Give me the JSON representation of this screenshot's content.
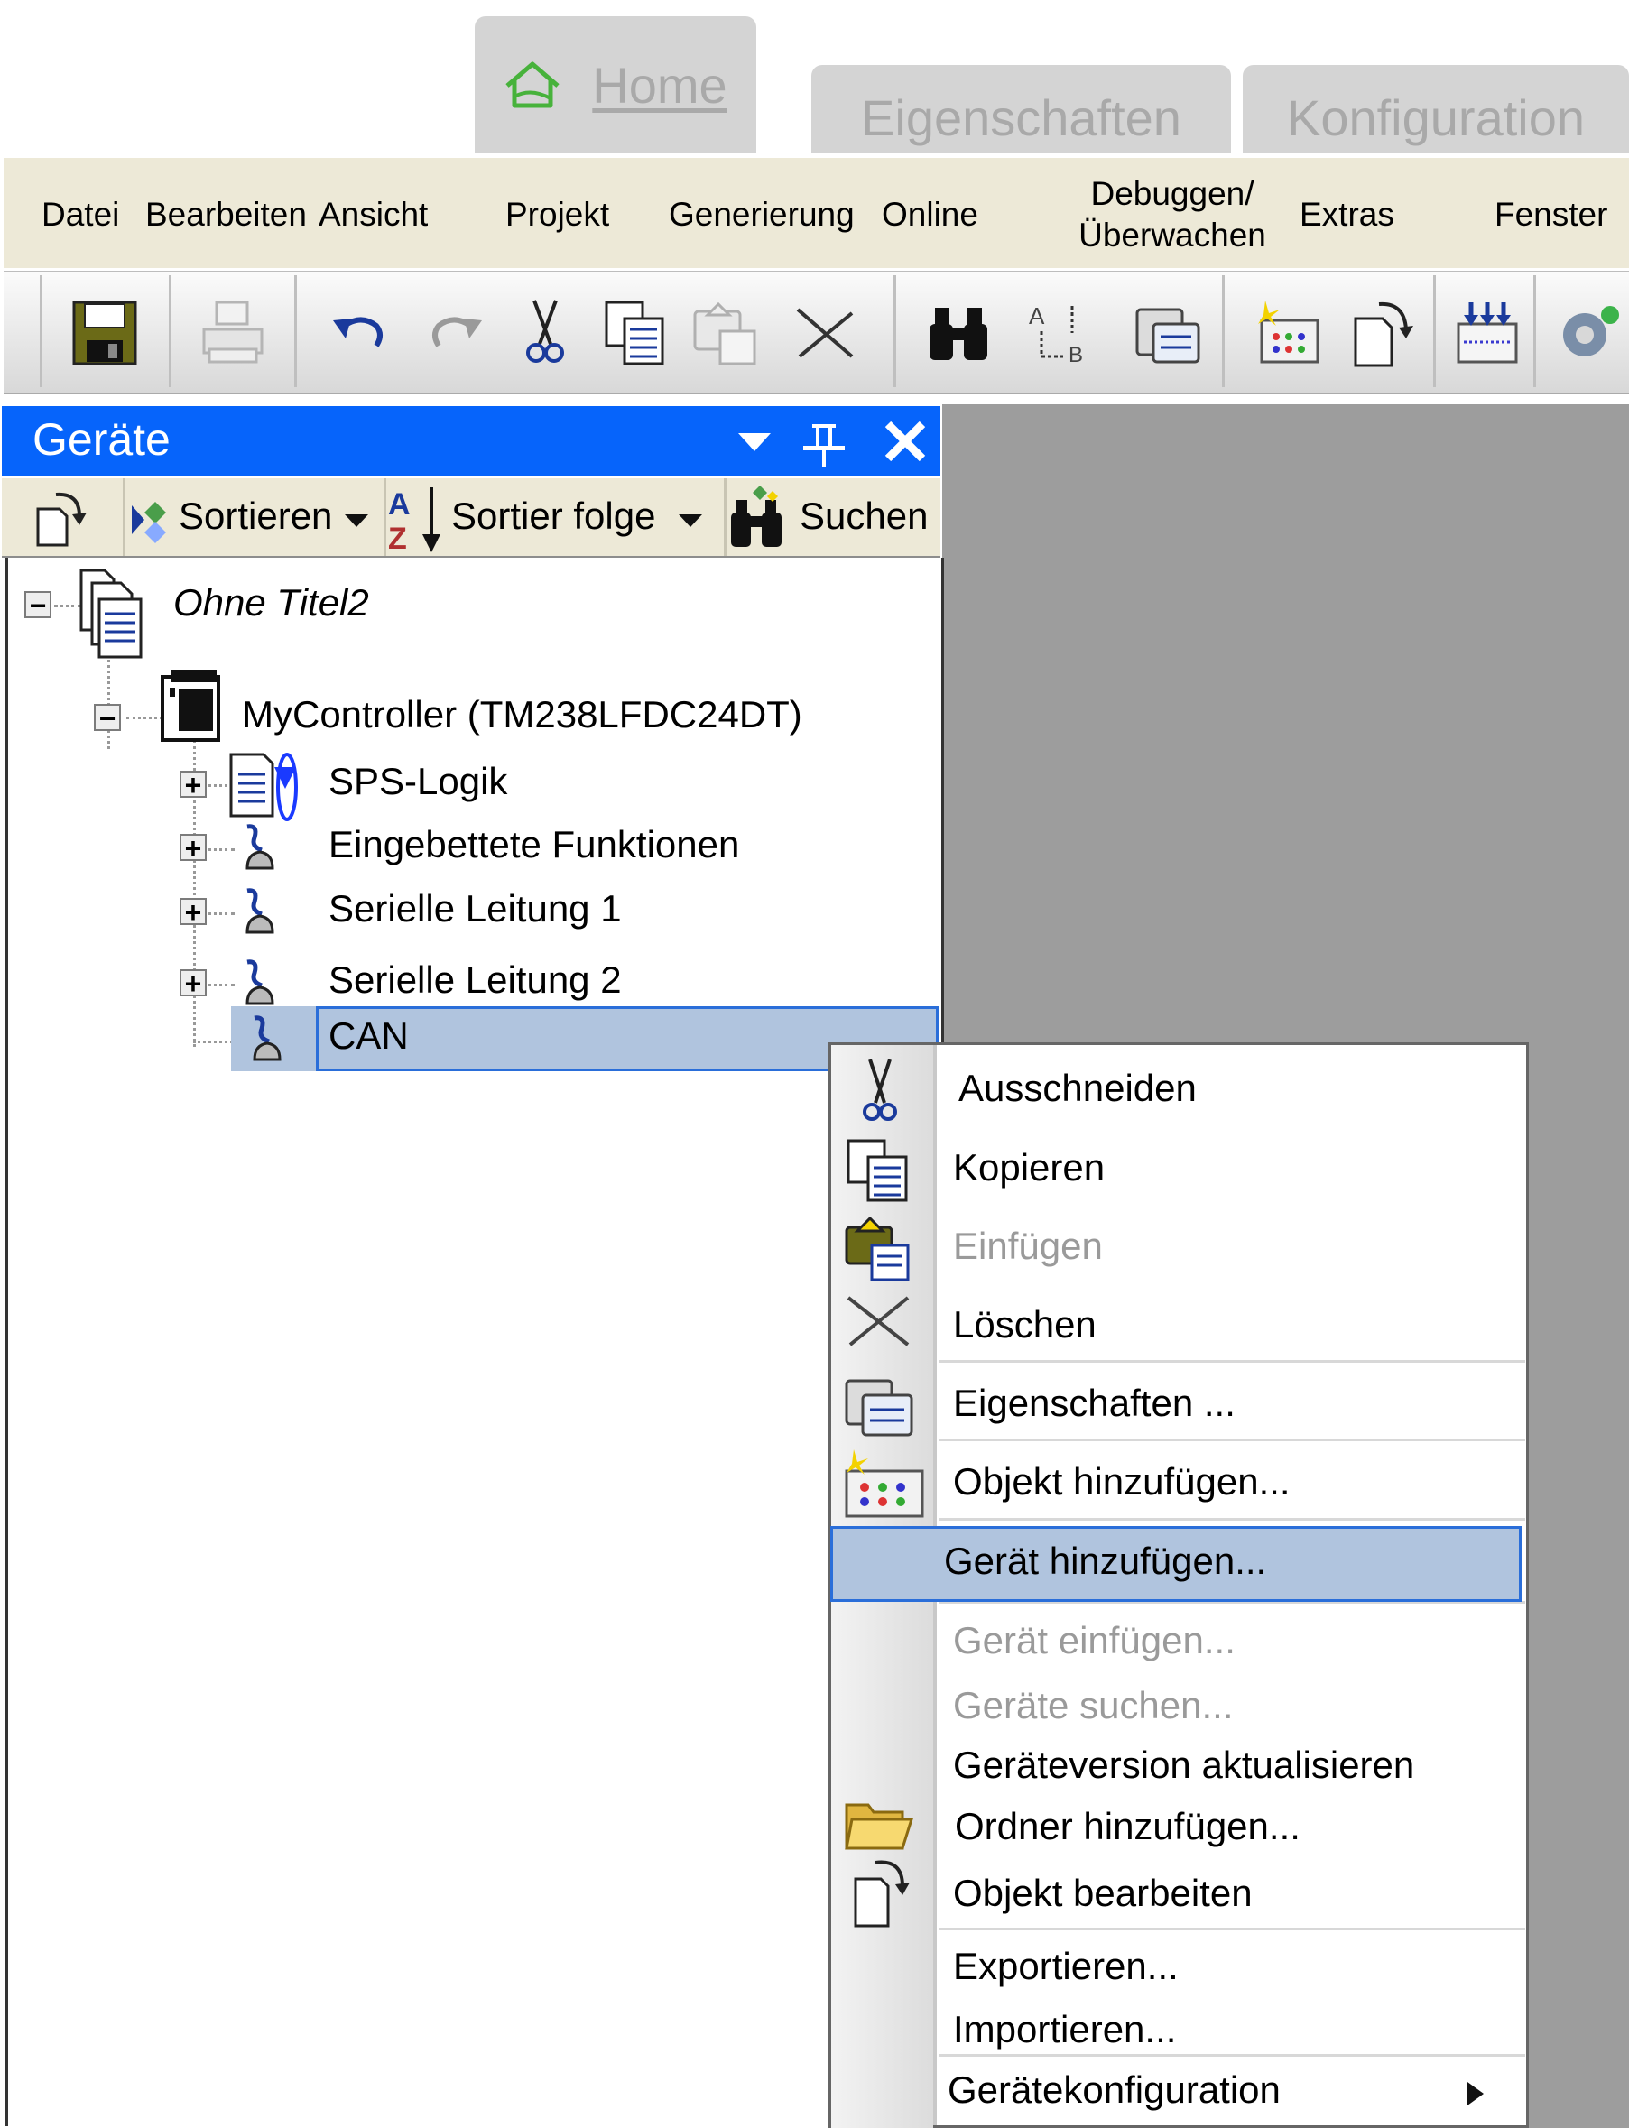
{
  "tabs": {
    "home": "Home",
    "eigenschaften": "Eigenschaften",
    "konfiguration": "Konfiguration"
  },
  "menubar": {
    "datei": "Datei",
    "bearbeiten": "Bearbeiten",
    "ansicht": "Ansicht",
    "projekt": "Projekt",
    "generierung": "Generierung",
    "online": "Online",
    "debuggen_1": "Debuggen/",
    "debuggen_2": "Überwachen",
    "extras": "Extras",
    "fenster": "Fenster"
  },
  "panel": {
    "title": "Geräte",
    "sortieren": "Sortieren",
    "sortierfolge": "Sortier folge",
    "suchen": "Suchen"
  },
  "tree": {
    "root": "Ohne Titel2",
    "controller": "MyController (TM238LFDC24DT)",
    "children": [
      "SPS-Logik",
      "Eingebettete Funktionen",
      "Serielle Leitung 1",
      "Serielle Leitung 2",
      "CAN"
    ],
    "selected": "CAN"
  },
  "context_menu": {
    "ausschneiden": "Ausschneiden",
    "kopieren": "Kopieren",
    "einfuegen": "Einfügen",
    "loeschen": "Löschen",
    "eigenschaften": "Eigenschaften ...",
    "objekt_hinzufuegen": "Objekt hinzufügen...",
    "geraet_hinzufuegen": "Gerät hinzufügen...",
    "geraet_einfuegen": "Gerät einfügen...",
    "geraete_suchen": "Geräte suchen...",
    "geraeteversion": "Geräteversion aktualisieren",
    "ordner_hinzufuegen": "Ordner hinzufügen...",
    "objekt_bearbeiten": "Objekt bearbeiten",
    "exportieren": "Exportieren...",
    "importieren": "Importieren...",
    "geraetekonfiguration": "Gerätekonfiguration",
    "highlighted": "Gerät hinzufügen..."
  },
  "colors": {
    "panel_title": "#0664fb",
    "selection": "#b0c4de",
    "selection_border": "#2a6ed9",
    "menubar": "#ede9d7",
    "workspace": "#9d9d9d",
    "tab": "#d4d4d4"
  }
}
